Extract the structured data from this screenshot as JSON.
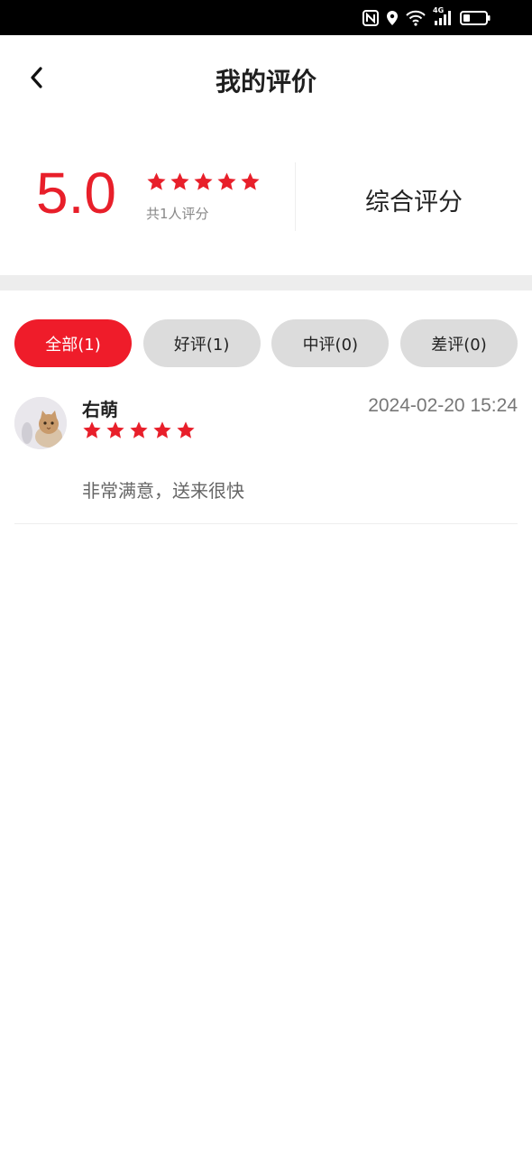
{
  "status_bar": {
    "icons": [
      "nfc-icon",
      "location-icon",
      "wifi-icon",
      "signal-4g-icon",
      "battery-icon"
    ],
    "network_label": "4G"
  },
  "header": {
    "title": "我的评价",
    "back_icon": "chevron-left-icon"
  },
  "summary": {
    "score": "5.0",
    "stars": 5,
    "count_text": "共1人评分",
    "overall_label": "综合评分"
  },
  "tabs": [
    {
      "label": "全部(1)",
      "active": true
    },
    {
      "label": "好评(1)",
      "active": false
    },
    {
      "label": "中评(0)",
      "active": false
    },
    {
      "label": "差评(0)",
      "active": false
    }
  ],
  "reviews": [
    {
      "name": "右萌",
      "time": "2024-02-20 15:24",
      "stars": 5,
      "text": "非常满意，送来很快"
    }
  ],
  "colors": {
    "accent": "#ef1c2a",
    "score": "#e81f2a",
    "tab_inactive": "#dcdcdc",
    "band": "#ededed"
  }
}
